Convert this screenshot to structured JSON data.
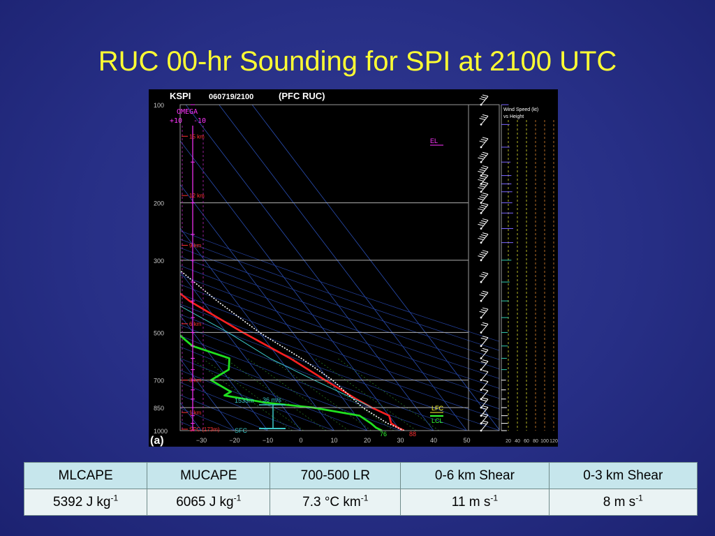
{
  "page": {
    "title": "RUC 00-hr Sounding for SPI at 2100 UTC"
  },
  "chart_data": {
    "type": "line",
    "station": "KSPI",
    "datetime": "060719/2100",
    "model": "(PFC RUC)",
    "panel_label": "(a)",
    "omega_label": "OMEGA",
    "omega_ticks": [
      "+10",
      "-10"
    ],
    "wind_panel_title": [
      "Wind Speed (kt)",
      "vs Height"
    ],
    "wind_axis_ticks": [
      "20",
      "40",
      "60",
      "80",
      "100",
      "120"
    ],
    "x_axis": {
      "label": "",
      "ticks": [
        -30,
        -20,
        -10,
        0,
        10,
        20,
        30,
        40,
        50
      ],
      "xlim": [
        -40,
        50
      ]
    },
    "y_axis": {
      "label": "",
      "scale": "log",
      "ticks": [
        100,
        200,
        300,
        500,
        700,
        850,
        1000
      ],
      "ylim": [
        1000,
        100
      ]
    },
    "height_markers": [
      "15 km",
      "12 km",
      "9 km",
      "6 km",
      "3 km",
      "1 km",
      "SFC (173m)"
    ],
    "level_labels": [
      "EL",
      "LFC",
      "LCL"
    ],
    "annotations": {
      "effective_inflow_top": "1533m",
      "storm_relative_wind": "36 m/s",
      "surface": "SFC",
      "surface_dewpoint": "76",
      "surface_temperature": "88"
    },
    "series": [
      {
        "name": "",
        "color": "#ff2020",
        "points": [
          [
            88,
            1000
          ],
          [
            86,
            980
          ],
          [
            84,
            950
          ],
          [
            86,
            900
          ],
          [
            80,
            850
          ],
          [
            75,
            800
          ],
          [
            66,
            700
          ],
          [
            56,
            600
          ],
          [
            41,
            500
          ],
          [
            25,
            400
          ],
          [
            14,
            300
          ],
          [
            2,
            250
          ],
          [
            -14,
            200
          ],
          [
            -24,
            170
          ],
          [
            -36,
            150
          ],
          [
            -50,
            125
          ],
          [
            -62,
            100
          ]
        ]
      },
      {
        "name": "",
        "color": "#20e020",
        "points": [
          [
            76,
            1000
          ],
          [
            74,
            980
          ],
          [
            73,
            950
          ],
          [
            70,
            900
          ],
          [
            48,
            850
          ],
          [
            24,
            820
          ],
          [
            5,
            780
          ],
          [
            10,
            760
          ],
          [
            4,
            700
          ],
          [
            18,
            650
          ],
          [
            23,
            600
          ],
          [
            8,
            550
          ],
          [
            5,
            500
          ],
          [
            -6,
            400
          ],
          [
            -32,
            350
          ],
          [
            -38,
            300
          ],
          [
            -27,
            250
          ],
          [
            -29,
            200
          ],
          [
            -40,
            165
          ],
          [
            -47,
            150
          ],
          [
            -45,
            125
          ],
          [
            -55,
            100
          ]
        ]
      },
      {
        "name": "",
        "color": "#ffffff",
        "points": [
          [
            88,
            1000
          ],
          [
            82,
            950
          ],
          [
            75,
            850
          ],
          [
            70,
            700
          ],
          [
            62,
            600
          ],
          [
            50,
            500
          ],
          [
            40,
            400
          ],
          [
            30,
            300
          ],
          [
            22,
            250
          ],
          [
            10,
            200
          ],
          [
            -5,
            150
          ],
          [
            -20,
            125
          ],
          [
            -35,
            100
          ]
        ]
      },
      {
        "name": "",
        "color": "#3cc8c8",
        "points": [
          [
            80,
            850
          ],
          [
            74,
            800
          ],
          [
            60,
            700
          ],
          [
            45,
            600
          ],
          [
            33,
            500
          ],
          [
            15,
            400
          ],
          [
            4,
            300
          ],
          [
            -10,
            250
          ],
          [
            -15,
            200
          ]
        ]
      }
    ],
    "winds": [
      {
        "p": 100,
        "spd": 25
      },
      {
        "p": 115,
        "spd": 30
      },
      {
        "p": 135,
        "spd": 30
      },
      {
        "p": 150,
        "spd": 35
      },
      {
        "p": 165,
        "spd": 40
      },
      {
        "p": 175,
        "spd": 40
      },
      {
        "p": 185,
        "spd": 45
      },
      {
        "p": 200,
        "spd": 45
      },
      {
        "p": 215,
        "spd": 50
      },
      {
        "p": 240,
        "spd": 50
      },
      {
        "p": 265,
        "spd": 50
      },
      {
        "p": 300,
        "spd": 40
      },
      {
        "p": 350,
        "spd": 30
      },
      {
        "p": 400,
        "spd": 25
      },
      {
        "p": 450,
        "spd": 25
      },
      {
        "p": 500,
        "spd": 20
      },
      {
        "p": 550,
        "spd": 20
      },
      {
        "p": 600,
        "spd": 15
      },
      {
        "p": 650,
        "spd": 15
      },
      {
        "p": 700,
        "spd": 10
      },
      {
        "p": 750,
        "spd": 10
      },
      {
        "p": 800,
        "spd": 10
      },
      {
        "p": 850,
        "spd": 15
      },
      {
        "p": 900,
        "spd": 20
      },
      {
        "p": 950,
        "spd": 20
      },
      {
        "p": 1000,
        "spd": 15
      }
    ]
  },
  "table": {
    "headers": [
      "MLCAPE",
      "MUCAPE",
      "700-500 LR",
      "0-6 km Shear",
      "0-3 km Shear"
    ],
    "values": [
      {
        "value": "5392 J kg",
        "exp": "-1"
      },
      {
        "value": "6065 J kg",
        "exp": "-1"
      },
      {
        "value": "7.3 °C km",
        "exp": "-1"
      },
      {
        "value": "11 m s",
        "exp": "-1"
      },
      {
        "value": "8 m s",
        "exp": "-1"
      }
    ]
  }
}
